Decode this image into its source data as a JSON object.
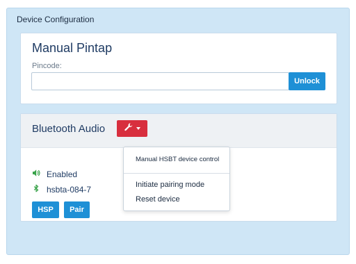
{
  "config": {
    "title": "Device Configuration"
  },
  "manual_pintap": {
    "title": "Manual Pintap",
    "pincode_label": "Pincode:",
    "pincode_value": "",
    "unlock_label": "Unlock"
  },
  "bluetooth": {
    "title": "Bluetooth Audio",
    "status": "Enabled",
    "device_name": "hsbta-084-7",
    "hsp_label": "HSP",
    "pair_label": "Pair"
  },
  "dropdown": {
    "items": [
      {
        "label": "Manual HSBT device control"
      },
      {
        "label": "Initiate pairing mode"
      },
      {
        "label": "Reset device"
      }
    ]
  },
  "icons": {
    "tool": "wrench-icon",
    "volume": "volume-icon",
    "bluetooth": "bluetooth-icon"
  },
  "colors": {
    "primary": "#1e90d6",
    "danger": "#d82f3e",
    "success": "#3aa34a",
    "background": "#cfe6f6"
  }
}
